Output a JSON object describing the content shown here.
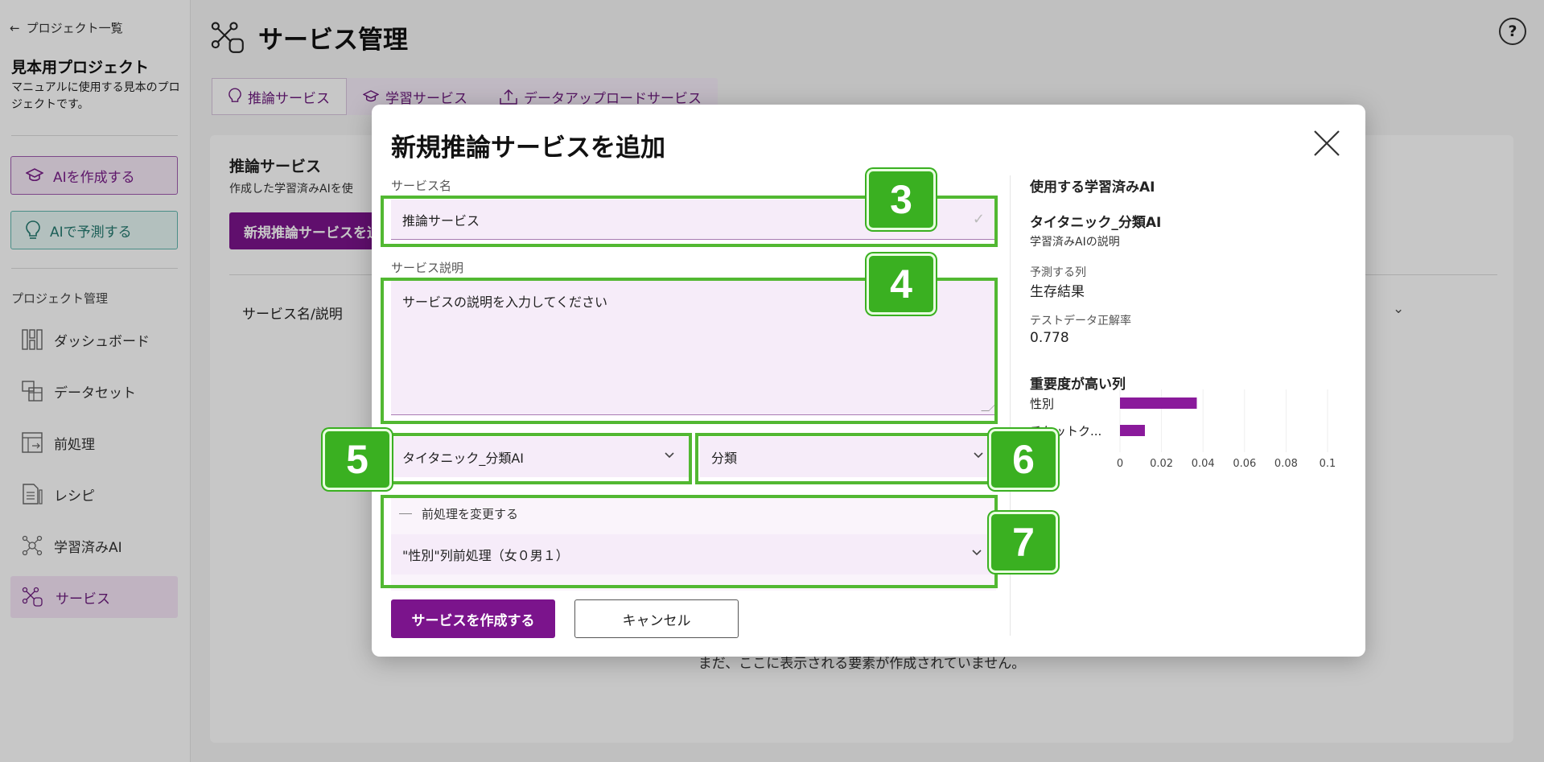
{
  "sidebar": {
    "back_label": "プロジェクト一覧",
    "project_name": "見本用プロジェクト",
    "project_description": "マニュアルに使用する見本のプロジェクトです。",
    "create_ai_label": "AIを作成する",
    "predict_ai_label": "AIで予測する",
    "section_title": "プロジェクト管理",
    "nav": [
      {
        "label": "ダッシュボード",
        "icon": "dashboard-icon"
      },
      {
        "label": "データセット",
        "icon": "dataset-icon"
      },
      {
        "label": "前処理",
        "icon": "preprocess-icon"
      },
      {
        "label": "レシピ",
        "icon": "recipe-icon"
      },
      {
        "label": "学習済みAI",
        "icon": "trained-ai-icon"
      },
      {
        "label": "サービス",
        "icon": "service-icon"
      }
    ]
  },
  "main": {
    "title": "サービス管理",
    "help_label": "?",
    "tabs": [
      {
        "label": "推論サービス"
      },
      {
        "label": "学習サービス"
      },
      {
        "label": "データアップロードサービス"
      }
    ],
    "panel": {
      "title": "推論サービス",
      "description": "作成した学習済みAIを使",
      "new_button": "新規推論サービスを追加",
      "column_header": "サービス名/説明",
      "empty_message": "まだ、ここに表示される要素が作成されていません。"
    }
  },
  "modal": {
    "title": "新規推論サービスを追加",
    "service_name_label": "サービス名",
    "service_name_value": "推論サービス",
    "service_desc_label": "サービス説明",
    "service_desc_placeholder": "サービスの説明を入力してください",
    "model_select_value": "タイタニック_分類AI",
    "type_select_value": "分類",
    "preprocess_toggle_label": "前処理を変更する",
    "preprocess_select_value": "\"性別\"列前処理（女０男１）",
    "submit_label": "サービスを作成する",
    "cancel_label": "キャンセル",
    "info": {
      "heading": "使用する学習済みAI",
      "model_name": "タイタニック_分類AI",
      "model_description": "学習済みAIの説明",
      "target_label": "予測する列",
      "target_value": "生存結果",
      "accuracy_label": "テストデータ正解率",
      "accuracy_value": "0.778",
      "importance_heading": "重要度が高い列"
    }
  },
  "chart_data": {
    "type": "bar",
    "orientation": "horizontal",
    "categories": [
      "性別",
      "チケットク..."
    ],
    "values": [
      0.037,
      0.012
    ],
    "xlim": [
      0,
      0.1
    ],
    "xticks": [
      "0",
      "0.02",
      "0.04",
      "0.06",
      "0.08",
      "0.1"
    ],
    "bar_color": "#8a1a9b"
  },
  "annotations": [
    "3",
    "4",
    "5",
    "6",
    "7"
  ],
  "colors": {
    "accent": "#7b148c",
    "highlight": "#52b832"
  }
}
